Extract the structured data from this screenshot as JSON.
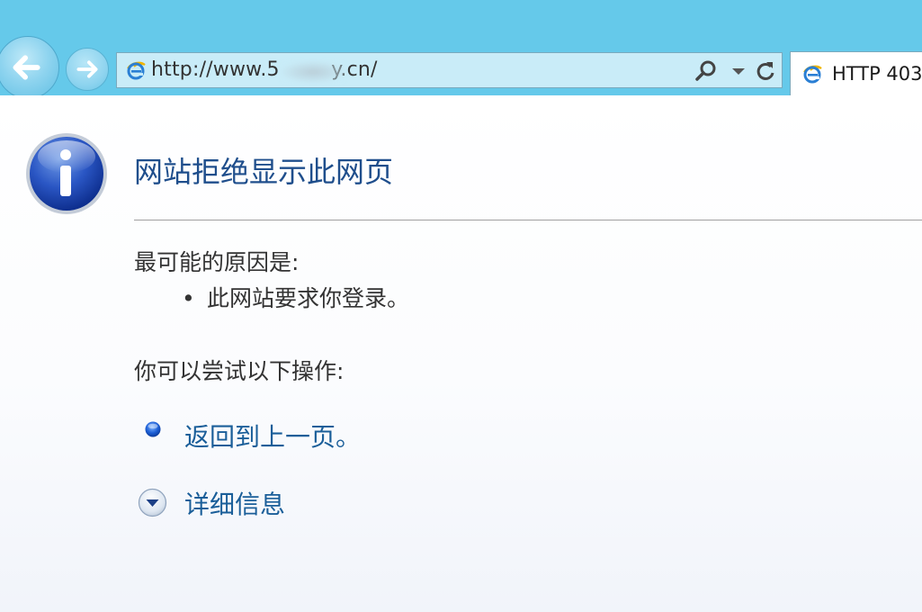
{
  "browser": {
    "address": "http://www.5        y.cn/",
    "tab_title": "HTTP 403"
  },
  "page": {
    "heading": "网站拒绝显示此网页",
    "reason_label": "最可能的原因是:",
    "reason_bullet": "•",
    "reason_item": "此网站要求你登录。",
    "try_label": "你可以尝试以下操作:",
    "back_action": "返回到上一页。",
    "details_action": "详细信息"
  },
  "icons": {
    "back": "back-arrow-icon",
    "forward": "forward-arrow-icon",
    "ie": "internet-explorer-icon",
    "search": "search-icon",
    "dropdown": "chevron-down-icon",
    "refresh": "refresh-icon",
    "info": "info-icon",
    "bullet": "blue-dot-icon",
    "details": "expand-icon"
  },
  "colors": {
    "chrome": "#65c9ea",
    "heading": "#1f4e8c",
    "link": "#1a5e99"
  }
}
